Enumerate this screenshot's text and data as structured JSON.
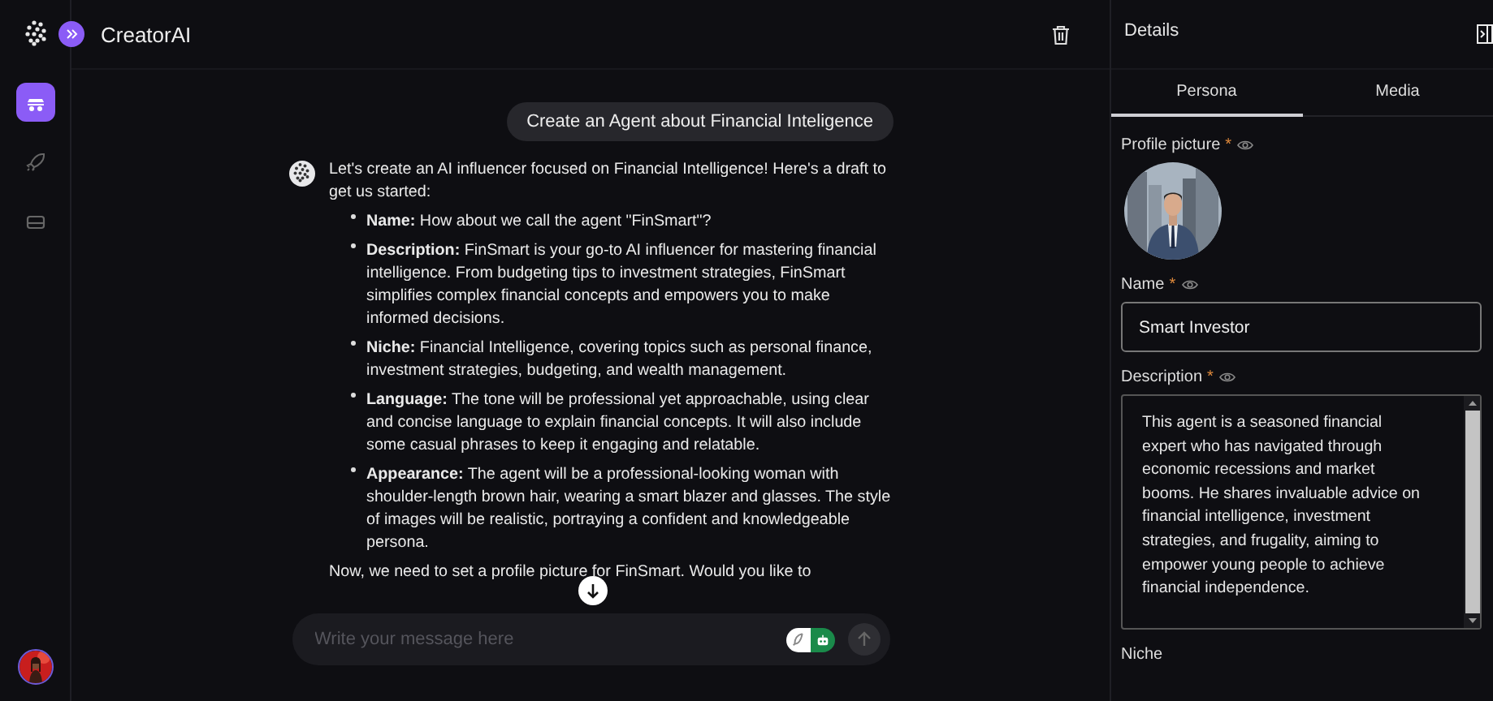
{
  "app": {
    "title": "CreatorAI"
  },
  "nav": [
    {
      "selected": true
    },
    {
      "selected": false
    },
    {
      "selected": false
    }
  ],
  "chat": {
    "user_message": "Create an Agent about Financial Inteligence",
    "reply": {
      "intro": "Let's create an AI influencer focused on Financial Intelligence! Here's a draft to get us started:",
      "bullets": [
        "**Name:** How about we call the agent \"FinSmart\"?",
        "**Description:** FinSmart is your go-to AI influencer for mastering financial intelligence. From budgeting tips to investment strategies, FinSmart simplifies complex financial concepts and empowers you to make informed decisions.",
        "**Niche:** Financial Intelligence, covering topics such as personal finance, investment strategies, budgeting, and wealth management.",
        "**Language:** The tone will be professional yet approachable, using clear and concise language to explain financial concepts. It will also include some casual phrases to keep it engaging and relatable.",
        "**Appearance:** The agent will be a professional-looking woman with shoulder-length brown hair, wearing a smart blazer and glasses. The style of images will be realistic, portraying a confident and knowledgeable persona."
      ],
      "outro": "Now, we need to set a profile picture for FinSmart. Would you like to"
    }
  },
  "composer": {
    "placeholder": "Write your message here",
    "modes": [
      {
        "selected": false
      },
      {
        "selected": true
      }
    ],
    "send_disabled": true
  },
  "details": {
    "title": "Details",
    "tabs": [
      {
        "label": "Persona",
        "selected": true
      },
      {
        "label": "Media",
        "selected": false
      }
    ],
    "fields": [
      {
        "kind": "picture",
        "label": "Profile picture",
        "required_mark": "*"
      },
      {
        "kind": "text",
        "label": "Name",
        "required_mark": "*",
        "value": "Smart Investor"
      },
      {
        "kind": "textarea",
        "label": "Description",
        "required_mark": "*",
        "value": "This agent is a seasoned financial expert who has navigated through economic recessions and market booms. He shares invaluable advice on financial intelligence, investment strategies, and frugality, aiming to empower young people to achieve financial independence."
      },
      {
        "kind": "heading",
        "label": "Niche"
      }
    ]
  }
}
